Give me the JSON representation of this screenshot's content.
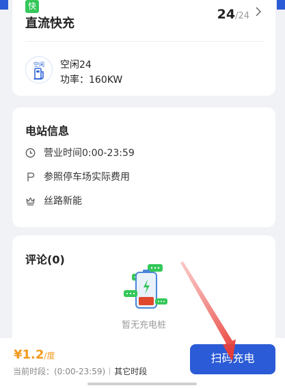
{
  "fast_section": {
    "badge": "快",
    "title": "直流快充",
    "available": "24",
    "total": "/24",
    "pile": {
      "status_tag": "空闲",
      "status": "空闲24",
      "power": "功率：160KW"
    }
  },
  "station_info": {
    "title": "电站信息",
    "hours": "营业时间0:00-23:59",
    "parking": "参照停车场实际费用",
    "operator": "丝路新能"
  },
  "comments": {
    "title": "评论(0)",
    "empty_text": "暂无充电桩"
  },
  "bottom_bar": {
    "price": "¥1.2",
    "price_unit": "/度",
    "period_label": "当前时段：(0:00-23:59)",
    "other_period": "其它时段",
    "scan_button": "扫码充电"
  },
  "colors": {
    "primary": "#2b5bd6",
    "price": "#f39a1c",
    "fast_badge": "#34c759",
    "annotation_arrow": "#e8322b"
  }
}
